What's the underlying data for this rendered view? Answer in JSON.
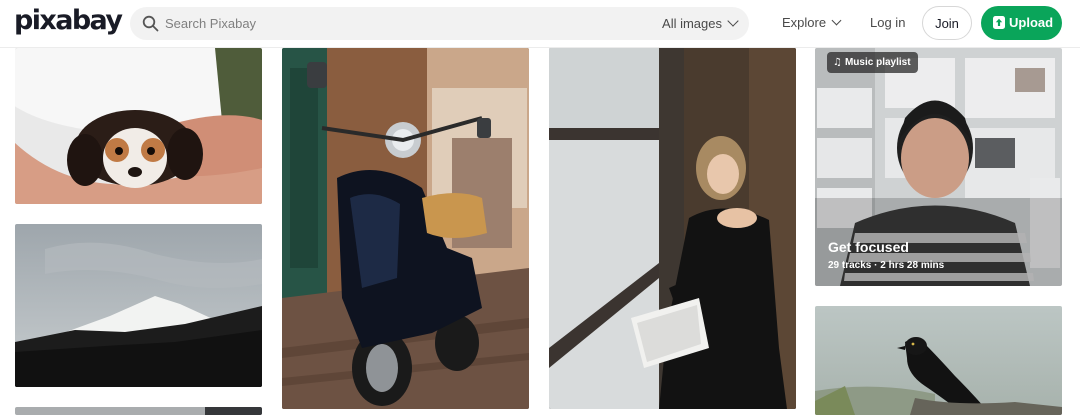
{
  "header": {
    "logo": "pixabay",
    "search_placeholder": "Search Pixabay",
    "filter_label": "All images",
    "explore_label": "Explore",
    "login_label": "Log in",
    "join_label": "Join",
    "upload_label": "Upload"
  },
  "playlist": {
    "badge": "Music playlist",
    "title": "Get focused",
    "meta": "29 tracks · 2 hrs 28 mins"
  },
  "colors": {
    "upload_green": "#0aa55a",
    "text_dark": "#191b26"
  }
}
